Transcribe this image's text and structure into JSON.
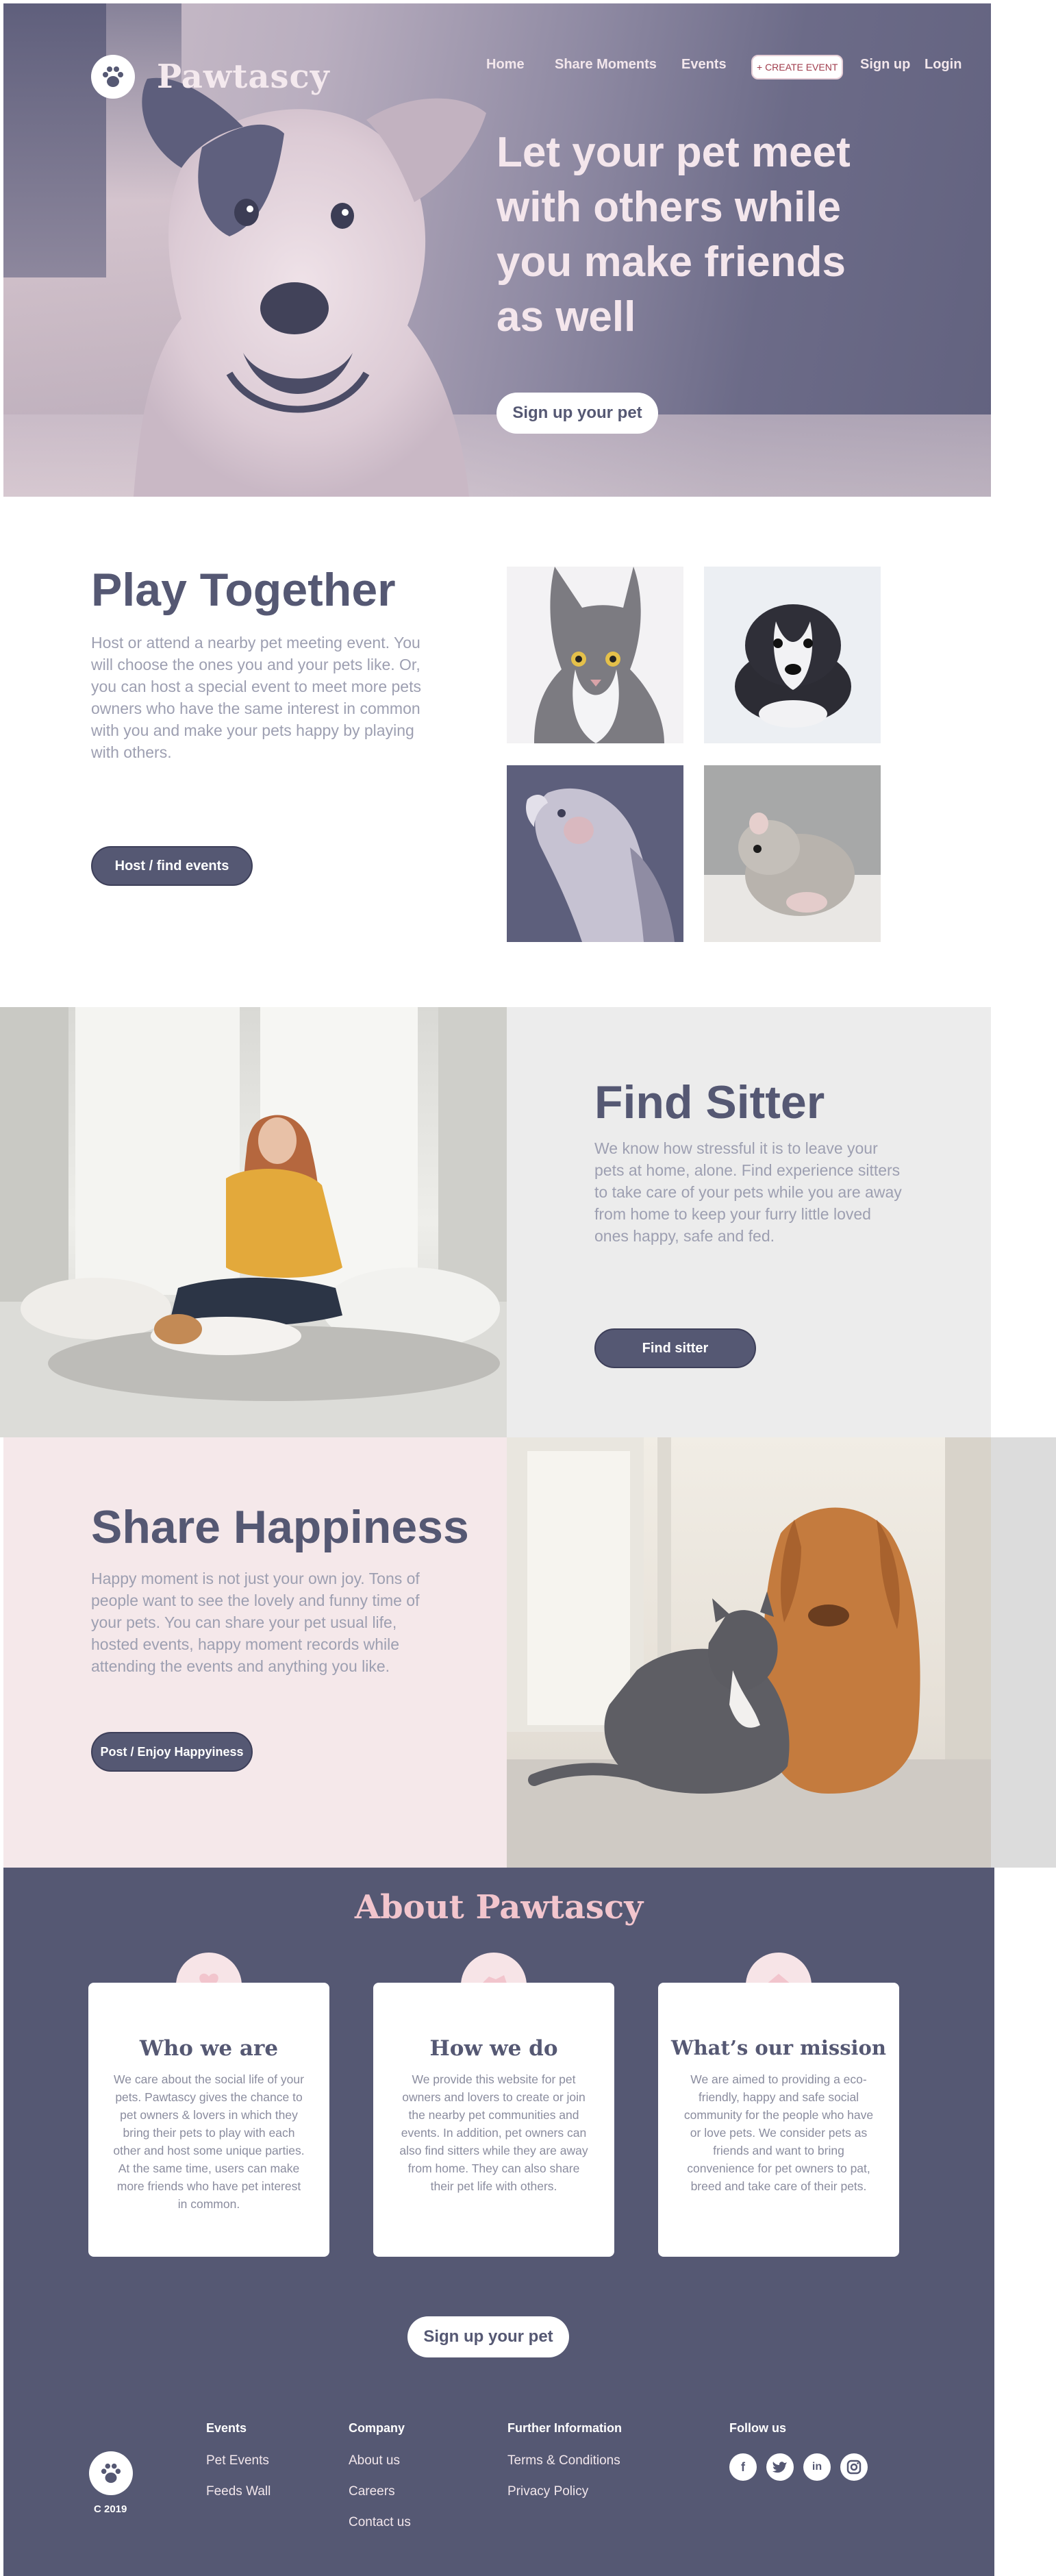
{
  "brand": {
    "name": "Pawtascy"
  },
  "nav": {
    "home": "Home",
    "share": "Share Moments",
    "events": "Events",
    "create": "+ CREATE EVENT",
    "signup": "Sign up",
    "login": "Login"
  },
  "hero": {
    "line1": "Let your pet meet",
    "line2": "with others while",
    "line3": "you make friends",
    "line4": "as well",
    "cta": "Sign up your pet"
  },
  "play": {
    "title": "Play Together",
    "text": "Host or attend a nearby pet meeting event. You will choose the ones you and your pets like. Or, you can host a special event to meet more pets owners who have the same interest in common with you and make your pets happy by playing with others.",
    "button": "Host / find events"
  },
  "sitter": {
    "title": "Find Sitter",
    "text": "We know how stressful it is to leave your pets at home, alone. Find experience sitters to take care of your pets while you are away from home to keep your furry little loved ones happy, safe and fed.",
    "button": "Find sitter"
  },
  "share": {
    "title": "Share Happiness",
    "text": "Happy moment is not just your own joy. Tons of people want to see the lovely and funny time of your pets. You can share your pet usual life, hosted events, happy moment records while attending the events and anything you like.",
    "button": "Post / Enjoy Happyiness"
  },
  "about": {
    "title": "About Pawtascy",
    "cards": [
      {
        "title": "Who we are",
        "text": "We care about the social life of your pets.  Pawtascy gives the chance to pet owners & lovers in which they bring their pets to play with each other and host some unique parties. At the same time, users can make more friends who have pet interest in common."
      },
      {
        "title": "How we do",
        "text": "We provide this website for pet owners and lovers to create or join the nearby pet communities and events. In addition, pet owners can also find sitters while they are away from home. They can also share their pet life with others."
      },
      {
        "title": "What’s our mission",
        "text": "We are aimed to providing a eco-friendly, happy and safe social community for the people who have or love pets. We consider pets as friends and want to bring convenience for pet owners to pat, breed and take care of their pets."
      }
    ],
    "cta": "Sign up your pet"
  },
  "footer": {
    "copyright": "C 2019",
    "events": {
      "heading": "Events",
      "links": [
        "Pet Events",
        "Feeds Wall"
      ]
    },
    "company": {
      "heading": "Company",
      "links": [
        "About us",
        "Careers",
        "Contact us"
      ]
    },
    "info": {
      "heading": "Further Information",
      "links": [
        "Terms & Conditions",
        "Privacy Policy"
      ]
    },
    "follow": {
      "heading": "Follow us",
      "icons": [
        "facebook-icon",
        "twitter-icon",
        "linkedin-icon",
        "instagram-icon"
      ]
    }
  },
  "colors": {
    "navy": "#555873",
    "pink": "#f5e8ea",
    "accent_pink": "#f2c5cd",
    "grey_panel": "#ececec"
  }
}
